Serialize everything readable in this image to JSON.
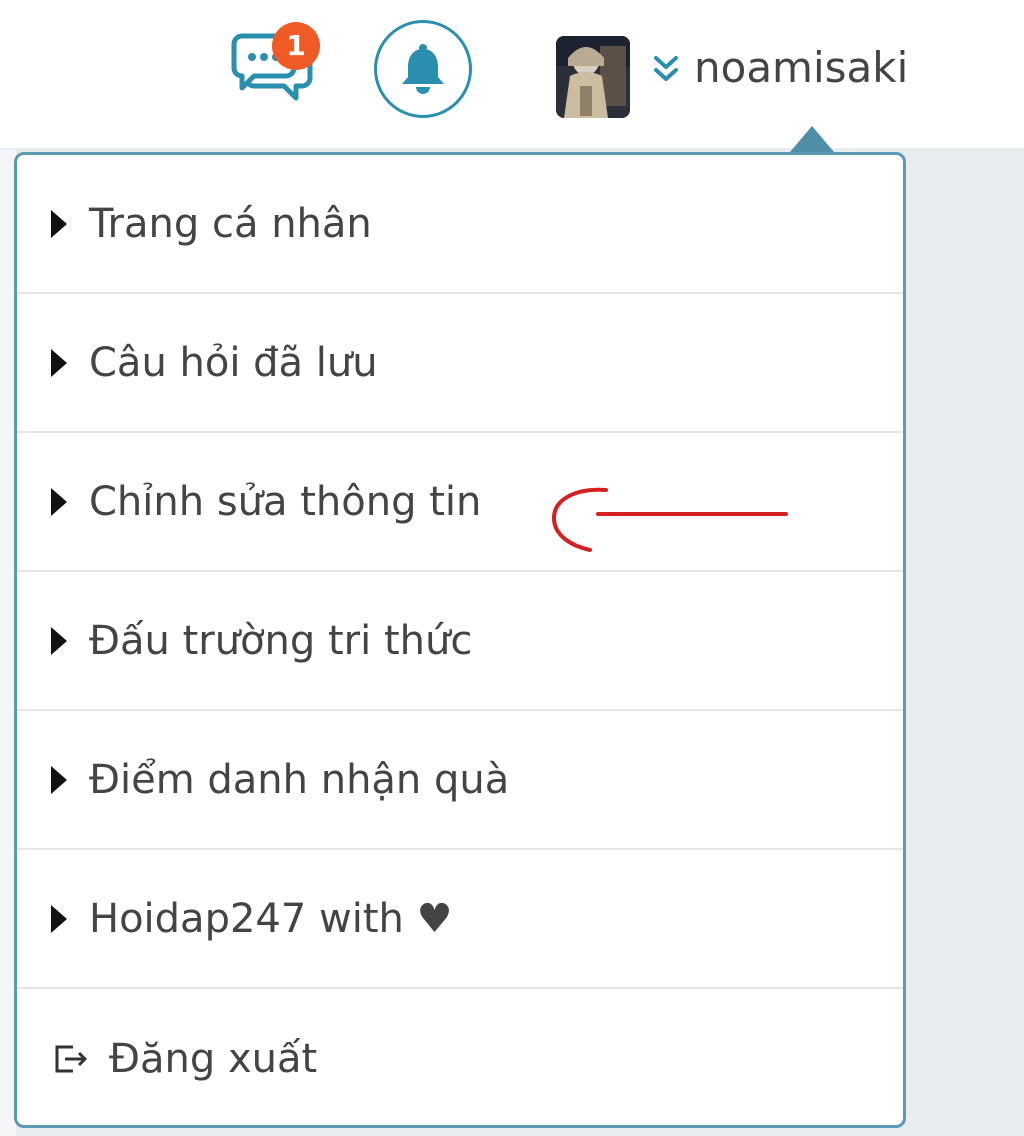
{
  "header": {
    "messages_badge_count": "1",
    "username": "noamisaki"
  },
  "menu": {
    "items": [
      {
        "label": "Trang cá nhân"
      },
      {
        "label": "Câu hỏi đã lưu"
      },
      {
        "label": "Chỉnh sửa thông tin"
      },
      {
        "label": "Đấu trường tri thức"
      },
      {
        "label": "Điểm danh nhận quà"
      },
      {
        "label": "Hoidap247 with ♥"
      }
    ],
    "logout_label": "Đăng xuất"
  },
  "colors": {
    "accent": "#2a8fae",
    "badge": "#f05a24",
    "menu_border": "#5b9ab3",
    "annotation": "#d42020"
  }
}
